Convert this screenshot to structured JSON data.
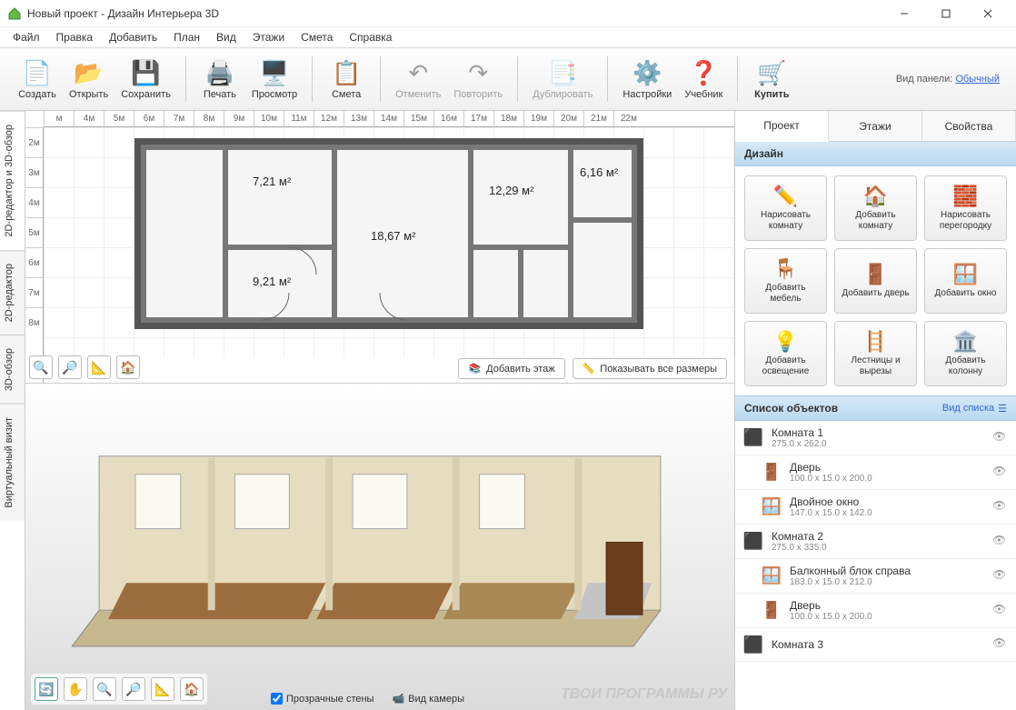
{
  "window": {
    "title": "Новый проект - Дизайн Интерьера 3D"
  },
  "menubar": [
    "Файл",
    "Правка",
    "Добавить",
    "План",
    "Вид",
    "Этажи",
    "Смета",
    "Справка"
  ],
  "toolbar": {
    "create": "Создать",
    "open": "Открыть",
    "save": "Сохранить",
    "print": "Печать",
    "preview": "Просмотр",
    "estimate": "Смета",
    "undo": "Отменить",
    "redo": "Повторить",
    "duplicate": "Дублировать",
    "settings": "Настройки",
    "tutorial": "Учебник",
    "buy": "Купить",
    "panel_label": "Вид панели:",
    "panel_mode": "Обычный"
  },
  "left_tabs": {
    "combo": "2D-редактор и 3D-обзор",
    "editor2d": "2D-редактор",
    "view3d": "3D-обзор",
    "virtual": "Виртуальный визит"
  },
  "ruler_h": [
    "м",
    "4м",
    "5м",
    "6м",
    "7м",
    "8м",
    "9м",
    "10м",
    "11м",
    "12м",
    "13м",
    "14м",
    "15м",
    "16м",
    "17м",
    "18м",
    "19м",
    "20м",
    "21м",
    "22м"
  ],
  "ruler_v": [
    "2м",
    "3м",
    "4м",
    "5м",
    "6м",
    "7м",
    "8м"
  ],
  "rooms": {
    "r1": "7,21 м²",
    "r2": "18,67 м²",
    "r3": "12,29 м²",
    "r4": "6,16 м²",
    "r5": "9,21 м²"
  },
  "floor_actions": {
    "add_floor": "Добавить этаж",
    "show_dims": "Показывать все размеры"
  },
  "view3d": {
    "trans_walls": "Прозрачные стены",
    "camera": "Вид камеры"
  },
  "right_tabs": {
    "project": "Проект",
    "floors": "Этажи",
    "props": "Свойства"
  },
  "design_header": "Дизайн",
  "design_buttons": {
    "draw_room": "Нарисовать комнату",
    "add_room": "Добавить комнату",
    "draw_partition": "Нарисовать перегородку",
    "add_furniture": "Добавить мебель",
    "add_door": "Добавить дверь",
    "add_window": "Добавить окно",
    "add_lighting": "Добавить освещение",
    "stairs_cutouts": "Лестницы и вырезы",
    "add_column": "Добавить колонну"
  },
  "objects_header": "Список объектов",
  "view_list": "Вид списка",
  "objects": [
    {
      "name": "Комната 1",
      "dims": "275.0 x 262.0",
      "type": "room"
    },
    {
      "name": "Дверь",
      "dims": "100.0 x 15.0 x 200.0",
      "type": "door",
      "child": true
    },
    {
      "name": "Двойное окно",
      "dims": "147.0 x 15.0 x 142.0",
      "type": "window",
      "child": true
    },
    {
      "name": "Комната 2",
      "dims": "275.0 x 335.0",
      "type": "room"
    },
    {
      "name": "Балконный блок справа",
      "dims": "183.0 x 15.0 x 212.0",
      "type": "window",
      "child": true
    },
    {
      "name": "Дверь",
      "dims": "100.0 x 15.0 x 200.0",
      "type": "door",
      "child": true
    },
    {
      "name": "Комната 3",
      "dims": "",
      "type": "room"
    }
  ],
  "watermark": "ТВОИ ПРОГРАММЫ РУ"
}
